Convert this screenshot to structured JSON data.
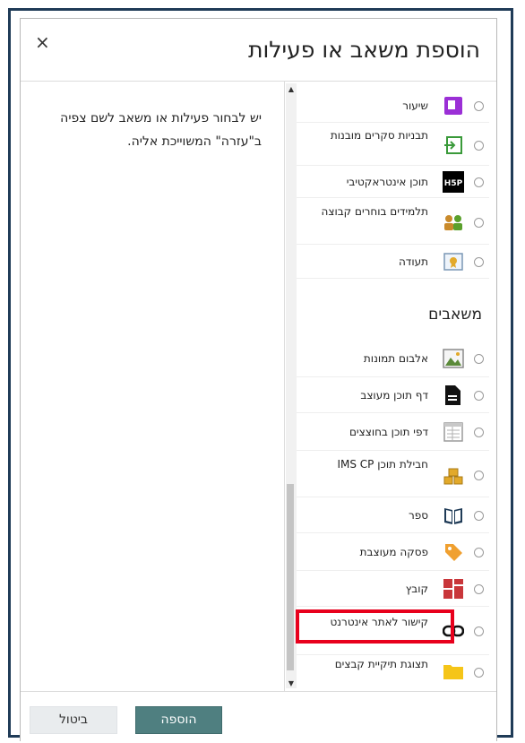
{
  "dialog": {
    "title": "הוספת משאב או פעילות",
    "close_label": "×",
    "help_text": "יש לבחור פעילות או משאב לשם צפיה ב\"עזרה\" המשוייכת אליה."
  },
  "activities": [
    {
      "label": "שיעור",
      "icon": "lesson-icon"
    },
    {
      "label": "תבניות סקרים מובנות",
      "icon": "survey-icon"
    },
    {
      "label": "תוכן אינטראקטיבי",
      "icon": "h5p-icon"
    },
    {
      "label": "תלמידים בוחרים קבוצה",
      "icon": "group-choice-icon"
    },
    {
      "label": "תעודה",
      "icon": "certificate-icon"
    }
  ],
  "resources_section": "משאבים",
  "resources": [
    {
      "label": "אלבום תמונות",
      "icon": "image-gallery-icon"
    },
    {
      "label": "דף תוכן מעוצב",
      "icon": "page-icon"
    },
    {
      "label": "דפי תוכן בחוצצים",
      "icon": "tabbed-page-icon"
    },
    {
      "label": "חבילת תוכן IMS CP",
      "icon": "ims-package-icon"
    },
    {
      "label": "ספר",
      "icon": "book-icon"
    },
    {
      "label": "פסקה מעוצבת",
      "icon": "label-tag-icon"
    },
    {
      "label": "קובץ",
      "icon": "file-icon"
    },
    {
      "label": "קישור לאתר אינטרנט",
      "icon": "url-link-icon"
    },
    {
      "label": "תצוגת תיקיית קבצים",
      "icon": "folder-icon"
    }
  ],
  "footer": {
    "add_label": "הוספה",
    "cancel_label": "ביטול"
  },
  "colors": {
    "add_button": "#4f7f80",
    "highlight": "#e8001c",
    "frame": "#1f3b57"
  }
}
